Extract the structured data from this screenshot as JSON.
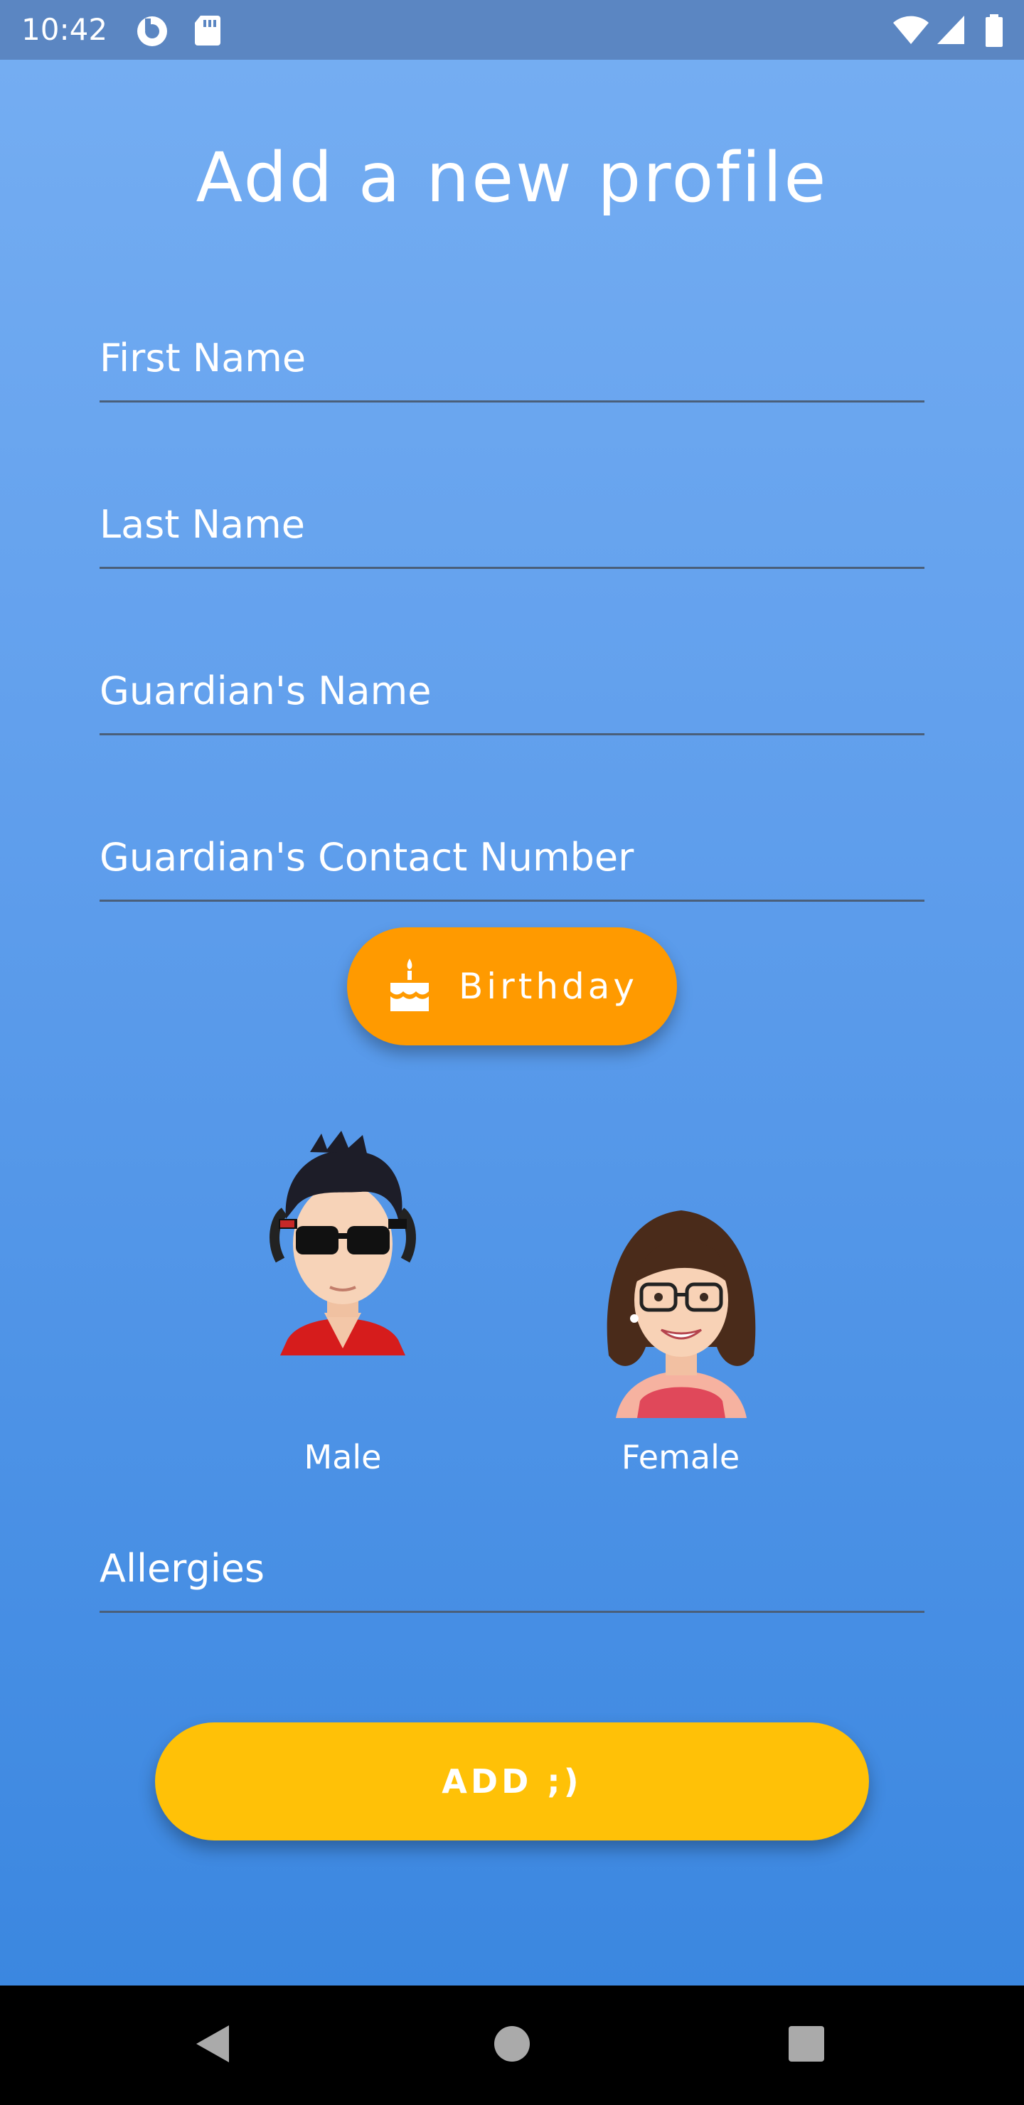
{
  "status_bar": {
    "time": "10:42",
    "left_icons": [
      "data-saver-icon",
      "sd-card-icon"
    ],
    "right_icons": [
      "wifi-icon",
      "signal-icon",
      "battery-icon"
    ]
  },
  "page": {
    "title": "Add a new profile"
  },
  "form": {
    "first_name": {
      "placeholder": "First Name",
      "value": ""
    },
    "last_name": {
      "placeholder": "Last Name",
      "value": ""
    },
    "guardian_name": {
      "placeholder": "Guardian's Name",
      "value": ""
    },
    "guardian_contact": {
      "placeholder": "Guardian's Contact Number",
      "value": ""
    },
    "birthday_button": {
      "label": "Birthday",
      "icon": "cake-icon"
    },
    "gender": {
      "male": {
        "label": "Male",
        "icon": "male-avatar"
      },
      "female": {
        "label": "Female",
        "icon": "female-avatar"
      }
    },
    "allergies": {
      "placeholder": "Allergies",
      "value": ""
    },
    "add_button": {
      "label": "ADD ;)"
    }
  },
  "nav_bar": {
    "icons": [
      "back-icon",
      "home-icon",
      "recents-icon"
    ]
  },
  "colors": {
    "status_bar": "#5b86c2",
    "gradient_top": "#74adf2",
    "gradient_bottom": "#3b87e0",
    "birthday_button": "#ff9a00",
    "add_button": "#ffc107",
    "field_underline": "#4a5f7a"
  }
}
